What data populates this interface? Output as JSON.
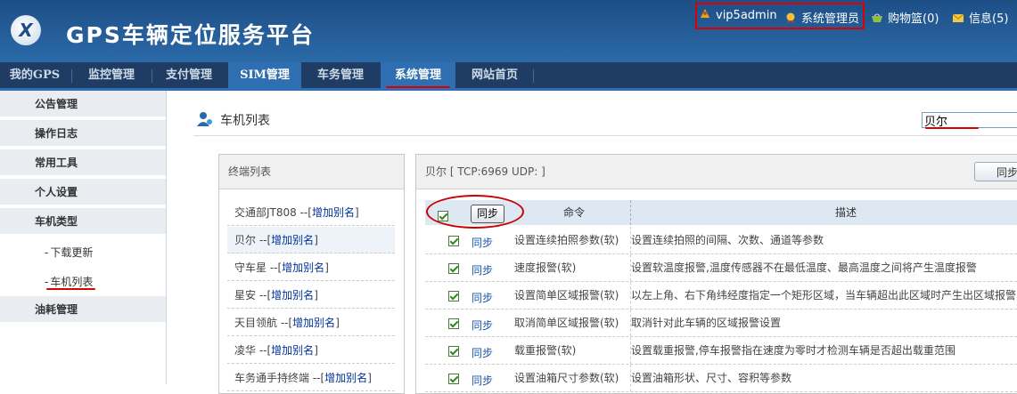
{
  "header": {
    "logo_letter": "X",
    "title": "GPS车辆定位服务平台",
    "username": "vip5admin",
    "role": "系统管理员",
    "cart": "购物篮(0)",
    "messages": "信息(5)"
  },
  "nav": {
    "items": [
      {
        "label": "我的GPS"
      },
      {
        "label": "监控管理"
      },
      {
        "label": "支付管理"
      },
      {
        "label": "SIM管理"
      },
      {
        "label": "车务管理"
      },
      {
        "label": "系统管理"
      },
      {
        "label": "网站首页"
      }
    ]
  },
  "sidebar": {
    "items": [
      {
        "label": "公告管理"
      },
      {
        "label": "操作日志"
      },
      {
        "label": "常用工具"
      },
      {
        "label": "个人设置"
      },
      {
        "label": "车机类型"
      },
      {
        "label": "油耗管理"
      }
    ],
    "subitems": [
      {
        "label": "下载更新"
      },
      {
        "label": "车机列表"
      }
    ]
  },
  "main": {
    "title": "车机列表",
    "search_value": "贝尔"
  },
  "terminal_panel": {
    "header": "终端列表",
    "add_alias": "增加别名",
    "rows": [
      {
        "name": "交通部JT808"
      },
      {
        "name": "贝尔"
      },
      {
        "name": "守车星"
      },
      {
        "name": "星安"
      },
      {
        "name": "天目领航"
      },
      {
        "name": "凌华"
      },
      {
        "name": "车务通手持终端"
      }
    ]
  },
  "command_panel": {
    "header": "贝尔 [ TCP:6969 UDP: ]",
    "sync_button": "同步",
    "columns": {
      "sync": "同步",
      "command": "命令",
      "description": "描述"
    },
    "row_sync_label": "同步",
    "rows": [
      {
        "command": "设置连续拍照参数(软)",
        "description": "设置连续拍照的间隔、次数、通道等参数"
      },
      {
        "command": "速度报警(软)",
        "description": "设置软温度报警,温度传感器不在最低温度、最高温度之间将产生温度报警"
      },
      {
        "command": "设置简单区域报警(软)",
        "description": "以左上角、右下角纬经度指定一个矩形区域，当车辆超出此区域时产生出区域报警"
      },
      {
        "command": "取消简单区域报警(软)",
        "description": "取消针对此车辆的区域报警设置"
      },
      {
        "command": "载重报警(软)",
        "description": "设置载重报警,停车报警指在速度为零时才检测车辆是否超出载重范围"
      },
      {
        "command": "设置油箱尺寸参数(软)",
        "description": "设置油箱形状、尺寸、容积等参数"
      }
    ]
  },
  "colors": {
    "header_bg": "#275f9b",
    "nav_bg": "#1f3d64",
    "nav_active": "#2f6eb0",
    "annotation_red": "#dd0000",
    "link_blue": "#003399"
  }
}
